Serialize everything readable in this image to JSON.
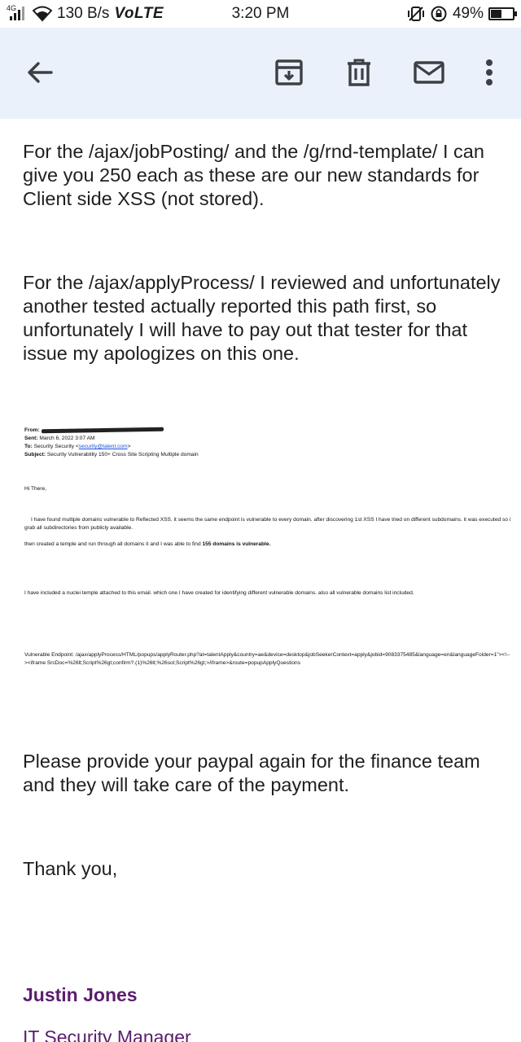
{
  "status_bar": {
    "network_type": "4G",
    "speed": "130 B/s",
    "volte": "VoLTE",
    "time": "3:20 PM",
    "battery": "49%",
    "battery_level": 0.49,
    "icons": [
      "signal-icon",
      "wifi-icon",
      "vibrate-icon",
      "rotation-lock-icon",
      "battery-icon"
    ]
  },
  "toolbar": {
    "back_icon": "arrow-left-icon",
    "archive_icon": "archive-icon",
    "delete_icon": "trash-icon",
    "mail_icon": "mail-icon",
    "more_icon": "more-vert-icon"
  },
  "email": {
    "paragraph_1": "For the /ajax/jobPosting/ and the /g/rnd-template/ I can give you 250 each as these are our new standards for Client side XSS (not stored).",
    "paragraph_2": "For the /ajax/applyProcess/ I reviewed and unfortunately another tested actually reported this path first, so unfortunately I will have to pay out that tester for that issue my apologizes on this one.",
    "embedded": {
      "from_label": "From:",
      "sent_label": "Sent:",
      "sent_value": "March 6, 2022 3:07 AM",
      "to_label": "To:",
      "to_value": "Security Security <",
      "to_email": "security@talent.com",
      "to_close": ">",
      "subject_label": "Subject:",
      "subject_value": "Security Vulnerability 150+ Cross Site Scripting Multiple domain",
      "greeting": "Hi There,",
      "found_text": "I have found multiple domains vulnerable to Reflected XSS. it seems the same endpoint is vulnerable to every domain. after discovering 1st XSS I have tried on different subdomains. it was executed so i grab all subdirectories from publicly available.",
      "template_text_pre": "then created a temple and run through all domains it and I was able to find ",
      "template_text_bold": "155 domains is vulnerable.",
      "nuclei_text": "I have included a nuclei temple attached to this email. which one I have created for identifying different vulnerable domains. also all vulnerable domains list included.",
      "endpoint_text": "Vulnerable Endpoint: /ajax/applyProcess/HTML/popups/applyRouter.php?at=talentApply&country=ae&device=desktop&jobSeekerContext=apply&jobid=9083375485&language=en&languageFolder=1\"><!--><iframe SrcDoc=%26lt;Script%26gt;confirm?.(1)%26lt;%26sol;Script%26gt;>/iframe>&route=popupApplyQuestions"
    },
    "paragraph_3": "Please provide your paypal again for the finance team and they will take care of the payment.",
    "closing": "Thank you,",
    "signature_name": "Justin Jones",
    "signature_title": "IT Security Manager"
  },
  "colors": {
    "toolbar_bg": "#eaf1fb",
    "signature": "#5b1d6e",
    "link": "#1a4fd6"
  }
}
